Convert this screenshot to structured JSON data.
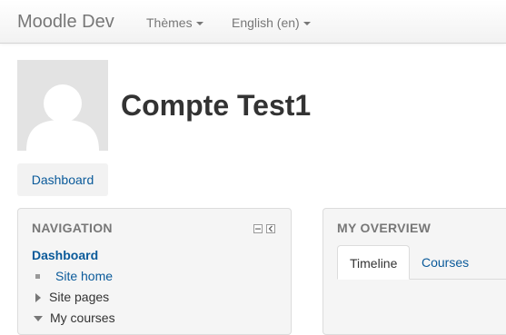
{
  "navbar": {
    "brand": "Moodle Dev",
    "themes_label": "Thèmes",
    "language_label": "English (en)"
  },
  "header": {
    "user_name": "Compte Test1",
    "dashboard_button": "Dashboard"
  },
  "navigation_block": {
    "title": "NAVIGATION",
    "items": [
      {
        "label": "Dashboard"
      },
      {
        "label": "Site home"
      },
      {
        "label": "Site pages"
      },
      {
        "label": "My courses"
      }
    ]
  },
  "overview_block": {
    "title": "MY OVERVIEW",
    "tabs": [
      {
        "label": "Timeline"
      },
      {
        "label": "Courses"
      }
    ]
  },
  "colors": {
    "link": "#0a5a9a",
    "navbar_text": "#777777",
    "avatar_bg": "#e3e3e3",
    "block_bg": "#f5f5f5"
  }
}
